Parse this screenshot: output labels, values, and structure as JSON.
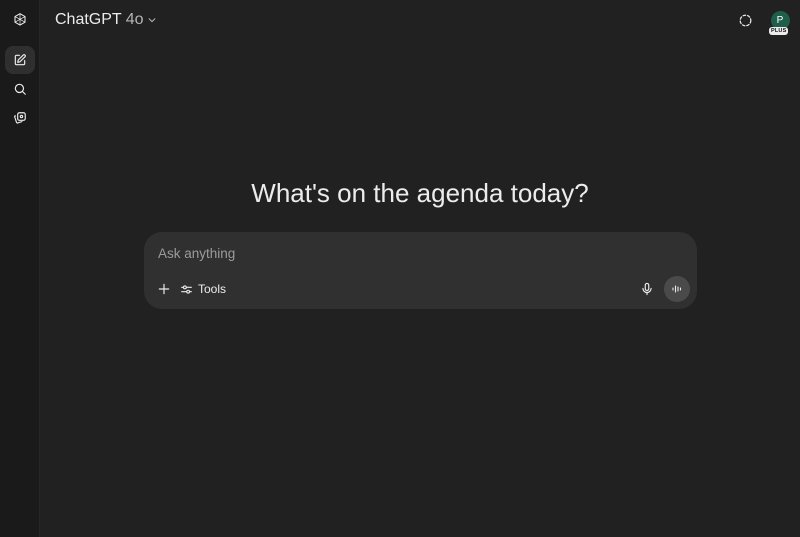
{
  "header": {
    "model_name": "ChatGPT",
    "model_version": "4o"
  },
  "account": {
    "avatar_initial": "P",
    "plan_badge": "PLUS",
    "avatar_color": "#1e5e4a"
  },
  "sidebar": {
    "items": [
      {
        "icon": "openai-logo-icon"
      },
      {
        "icon": "new-chat-icon"
      },
      {
        "icon": "search-icon"
      },
      {
        "icon": "library-icon"
      }
    ]
  },
  "main": {
    "headline": "What's on the agenda today?"
  },
  "composer": {
    "placeholder": "Ask anything",
    "tools_label": "Tools"
  },
  "theme": {
    "background": "#212121",
    "composer_bg": "#303030",
    "sidebar_bg": "#1a1a1a"
  }
}
